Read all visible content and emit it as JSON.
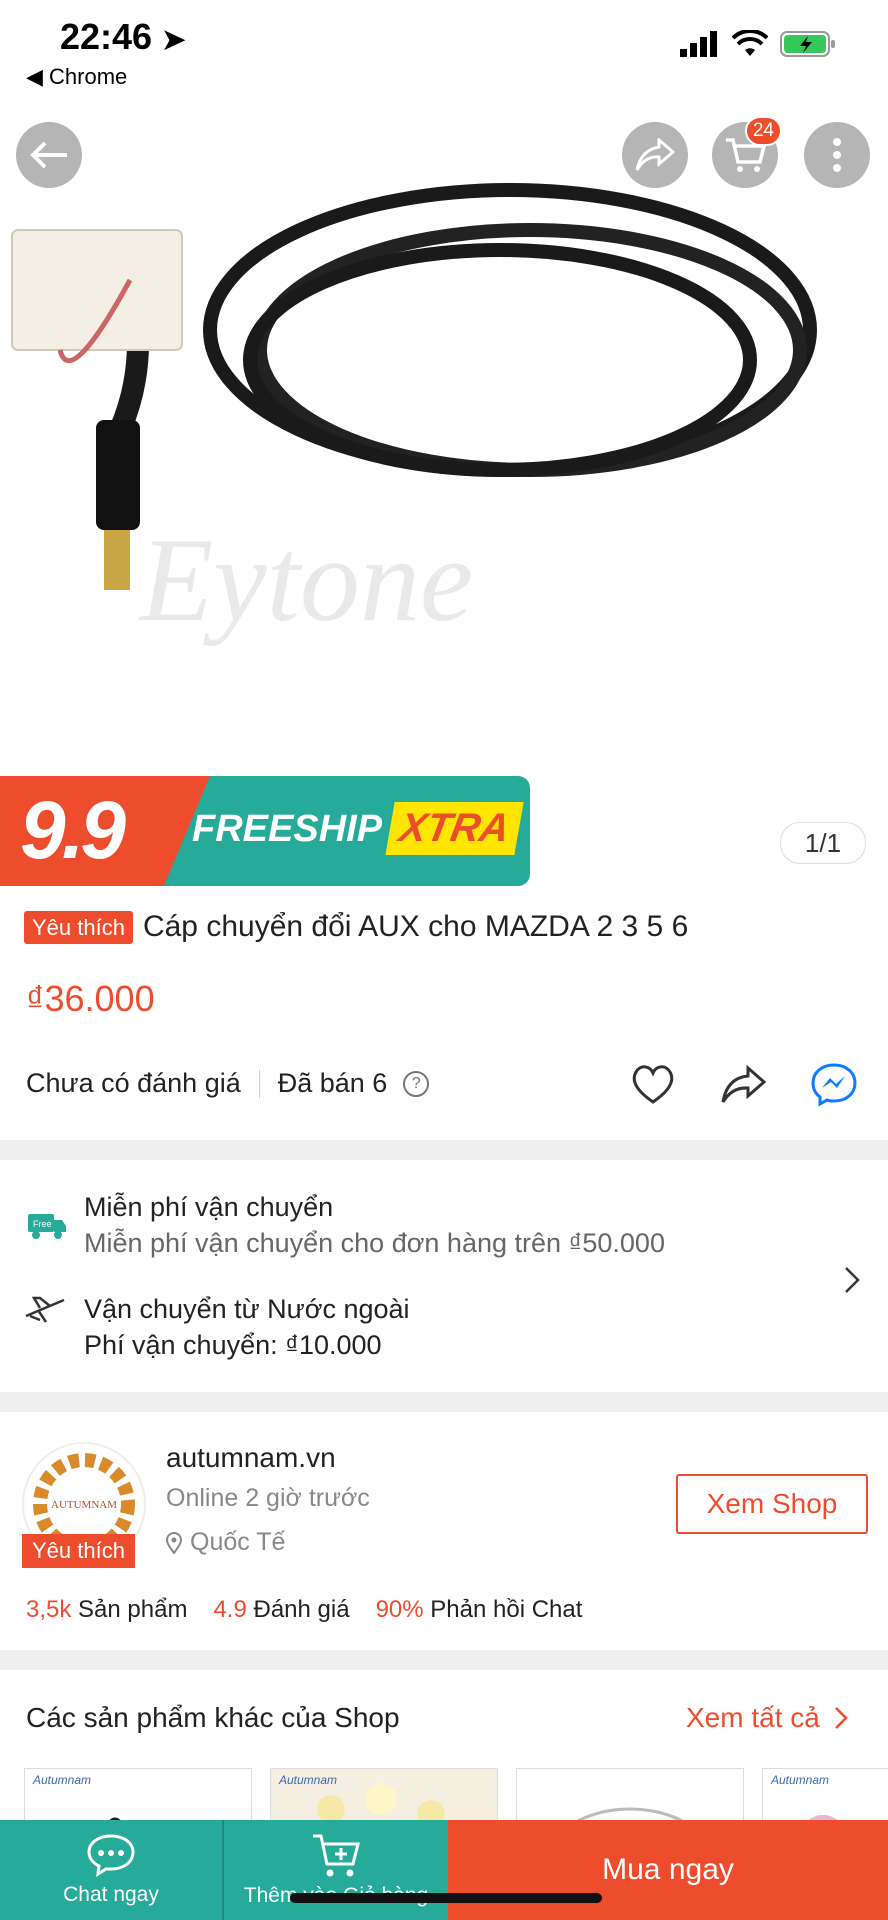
{
  "status_bar": {
    "time": "22:46",
    "back_app": "◀ Chrome"
  },
  "topnav": {
    "cart_count": "24"
  },
  "promo": {
    "big": "9.9",
    "freeship": "FREESHIP",
    "xtra": "XTRA"
  },
  "image_counter": "1/1",
  "product": {
    "fav_tag": "Yêu thích",
    "title": "Cáp chuyển đổi AUX cho MAZDA 2 3 5 6",
    "price": "₫36.000",
    "rating": "Chưa có đánh giá",
    "sold": "Đã bán 6",
    "watermark": "Eytone"
  },
  "shipping": {
    "free_title": "Miễn phí vận chuyển",
    "free_sub": "Miễn phí vận chuyển cho đơn hàng trên ₫50.000",
    "free_icon_text": "Free",
    "intl_title": "Vận chuyển từ Nước ngoài",
    "intl_fee": "Phí vận chuyển: ₫10.000"
  },
  "shop": {
    "name": "autumnam.vn",
    "online": "Online 2 giờ trước",
    "location": "Quốc Tế",
    "fav_tag": "Yêu thích",
    "view_button": "Xem Shop",
    "avatar_text": "AUTUMNAM",
    "products_count": "3,5k",
    "products_label": "Sản phẩm",
    "rating_value": "4.9",
    "rating_label": "Đánh giá",
    "chat_rate": "90%",
    "chat_label": "Phản hồi Chat"
  },
  "other_products": {
    "heading": "Các sản phẩm khác của Shop",
    "view_all": "Xem tất cả",
    "thumb_label": "Autumnam"
  },
  "bottom_bar": {
    "chat_label": "Chat ngay",
    "cart_label": "Thêm vào Giỏ hàng",
    "buy_label": "Mua ngay"
  }
}
